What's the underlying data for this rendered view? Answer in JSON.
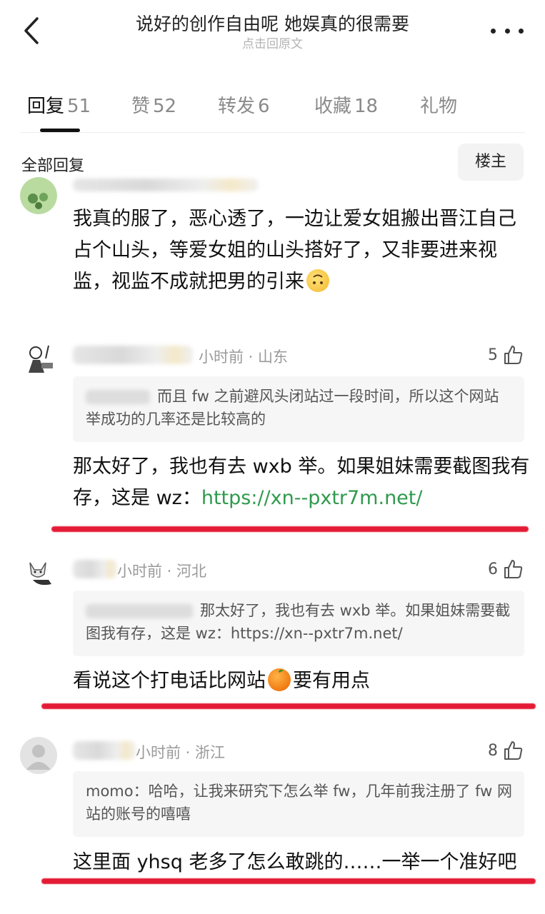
{
  "header": {
    "title": "说好的创作自由呢 她娱真的很需要",
    "subtitle": "点击回原文"
  },
  "tabs": [
    {
      "label": "回复",
      "count": "51"
    },
    {
      "label": "赞",
      "count": "52"
    },
    {
      "label": "转发",
      "count": "6"
    },
    {
      "label": "收藏",
      "count": "18"
    },
    {
      "label": "礼物",
      "count": ""
    }
  ],
  "filter": {
    "all_label": "全部回复",
    "op_label": "楼主"
  },
  "comments": [
    {
      "body": "我真的服了，恶心透了，一边让爱女姐搬出晋江自己占个山头，等爱女姐的山头搭好了，又非要进来视监，视监不成就把男的引来"
    },
    {
      "meta": "小时前 · 山东",
      "likes": "5",
      "quote": "而且 fw 之前避风头闭站过一段时间，所以这个网站举成功的几率还是比较高的",
      "body_prefix": "那太好了，我也有去 wxb 举。如果姐妹需要截图我有存，这是 wz：",
      "body_link": "https://xn--pxtr7m.net/"
    },
    {
      "meta": "小时前 · 河北",
      "likes": "6",
      "quote": "那太好了，我也有去 wxb 举。如果姐妹需要截图我有存，这是 wz：https://xn--pxtr7m.net/",
      "body_prefix": "看说这个打电话比网站",
      "body_suffix": "要有用点"
    },
    {
      "meta": "小时前 · 浙江",
      "likes": "8",
      "quote": "momo：哈哈，让我来研究下怎么举 fw，几年前我注册了 fw 网站的账号的嘻嘻",
      "body": "这里面 yhsq 老多了怎么敢跳的……一举一个准好吧"
    }
  ],
  "colors": {
    "link": "#2f9a4d",
    "highlight": "#e41b35"
  }
}
